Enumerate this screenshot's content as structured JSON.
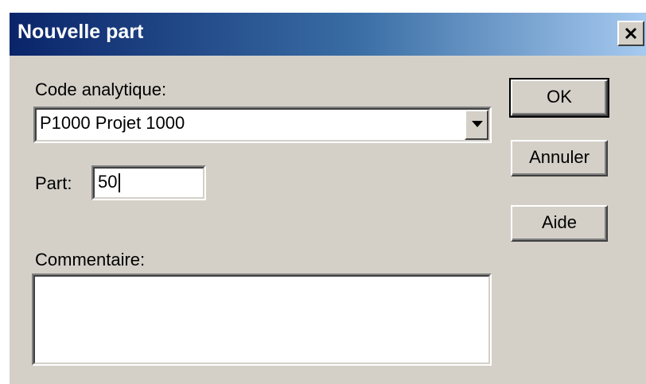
{
  "window": {
    "title": "Nouvelle part",
    "close_icon": "close-icon"
  },
  "form": {
    "code_label": "Code analytique:",
    "code_value": "P1000  Projet 1000",
    "dropdown_icon": "chevron-down-icon",
    "part_label": "Part:",
    "part_value": "50",
    "comment_label": "Commentaire:",
    "comment_value": ""
  },
  "buttons": {
    "ok": "OK",
    "cancel": "Annuler",
    "help": "Aide"
  },
  "colors": {
    "titlebar_start": "#0a246a",
    "titlebar_end": "#a6caf0",
    "dialog_bg": "#d4d0c8"
  }
}
